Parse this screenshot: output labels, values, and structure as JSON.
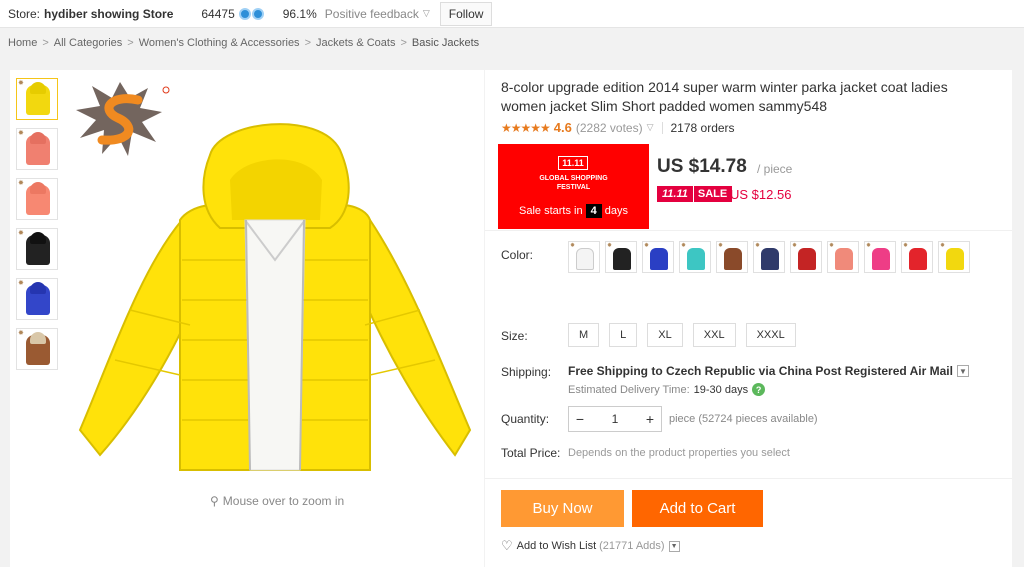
{
  "store": {
    "label": "Store:",
    "name": "hydiber showing Store",
    "score": "64475",
    "feedback_percent": "96.1%",
    "feedback_label": "Positive feedback",
    "follow_label": "Follow"
  },
  "breadcrumb": {
    "items": [
      "Home",
      "All Categories",
      "Women's Clothing & Accessories",
      "Jackets & Coats",
      "Basic Jackets"
    ],
    "separator": ">"
  },
  "gallery": {
    "zoom_hint": "Mouse over to zoom in",
    "thumb_colors": [
      "#f2d80f",
      "#f08070",
      "#f78872",
      "#222222",
      "#3346c9",
      "#9a5a32"
    ],
    "main_color": "#ffe20a"
  },
  "product": {
    "title": "8-color upgrade edition 2014 super warm winter parka jacket coat ladies women jacket Slim Short padded women sammy548",
    "rating_stars": "★★★★★",
    "rating": "4.6",
    "votes": "(2282 votes)",
    "orders": "2178 orders",
    "price": "US $14.78",
    "per_piece": "/ piece",
    "sale_tag_1": "11.11",
    "sale_tag_2": "SALE",
    "sale_price": "US $12.56"
  },
  "promo": {
    "badge": "11.11",
    "line1": "GLOBAL SHOPPING",
    "line2": "FESTIVAL",
    "starts_prefix": "Sale starts in",
    "days_count": "4",
    "days_label": "days"
  },
  "options": {
    "color_label": "Color:",
    "color_swatches": [
      "#ffffff",
      "#222222",
      "#2a3fc4",
      "#3dc6c3",
      "#8a4a2a",
      "#2f3a6a",
      "#c42424",
      "#f08a7a",
      "#ee3d86",
      "#e3242b",
      "#f2d80f"
    ],
    "size_label": "Size:",
    "sizes": [
      "M",
      "L",
      "XL",
      "XXL",
      "XXXL"
    ]
  },
  "shipping": {
    "label": "Shipping:",
    "main": "Free Shipping to Czech Republic via China Post Registered Air Mail",
    "est_label": "Estimated Delivery Time:",
    "est_value": "19-30 days"
  },
  "quantity": {
    "label": "Quantity:",
    "minus": "−",
    "value": "1",
    "plus": "+",
    "note": "piece (52724 pieces available)"
  },
  "total": {
    "label": "Total Price:",
    "note": "Depends on the product properties you select"
  },
  "actions": {
    "buy_now": "Buy Now",
    "add_to_cart": "Add to Cart",
    "wishlist": "Add to Wish List",
    "wishlist_adds": "(21771 Adds)"
  }
}
